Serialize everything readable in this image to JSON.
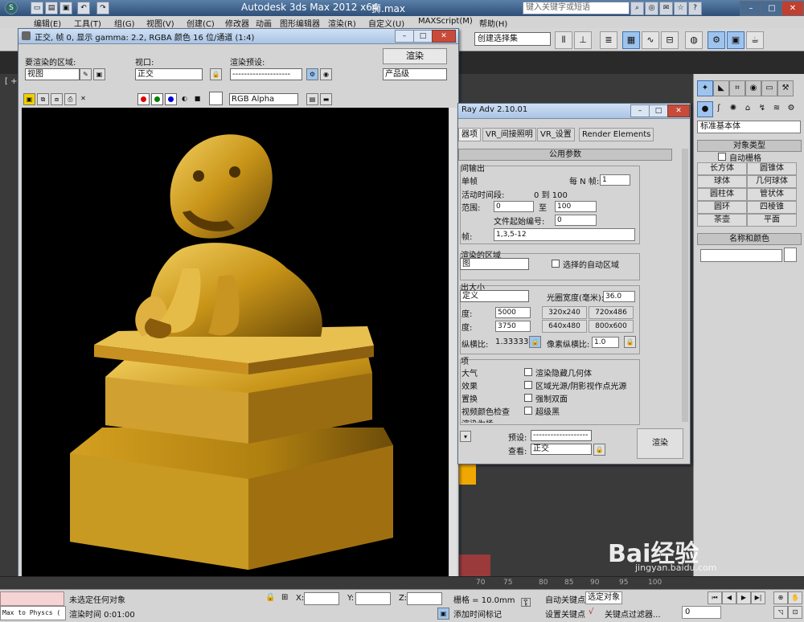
{
  "titlebar": {
    "title": "Autodesk 3ds Max  2012 x64",
    "file": "狮.max",
    "search_placeholder": "键入关键字或短语"
  },
  "menubar": {
    "items": [
      "编辑(E)",
      "工具(T)",
      "组(G)",
      "视图(V)",
      "创建(C)",
      "修改器",
      "动画",
      "图形编辑器",
      "渲染(R)",
      "自定义(U)",
      "MAXScript(M)",
      "帮助(H)"
    ]
  },
  "maintoolbar": {
    "selection_set": "创建选择集"
  },
  "viewport": {
    "label": "[ +"
  },
  "renderframe": {
    "title": "正交, 帧 0, 显示 gamma: 2.2, RGBA 颜色 16 位/通道 (1:4)",
    "area_label": "要渲染的区域:",
    "area_value": "视图",
    "viewport_label": "视口:",
    "viewport_value": "正交",
    "preset_label": "渲染预设:",
    "preset_value": "--------------------",
    "render_button": "渲染",
    "quality_value": "产品级",
    "channel_value": "RGB Alpha"
  },
  "rendersetup": {
    "title": "Ray Adv 2.10.01",
    "tabs": [
      "器项",
      "VR_间接照明",
      "VR_设置",
      "Render Elements"
    ],
    "rollout": "公用参数",
    "time_output_title": "间输出",
    "single": "单帧",
    "every_n": "每 N 帧:",
    "every_n_value": "1",
    "active_segment": "活动时间段:",
    "segment_value": "0 到 100",
    "range": "范围:",
    "range_start": "0",
    "range_to": "至",
    "range_end": "100",
    "file_start": "文件起始编号:",
    "file_start_value": "0",
    "frames_label": "帧:",
    "frames_value": "1,3,5-12",
    "area_title": "渲染的区域",
    "area_value": "图",
    "auto_region": "选择的自动区域",
    "size_title": "出大小",
    "custom": "定义",
    "aperture": "光圈宽度(毫米):",
    "aperture_value": "36.0",
    "width_label": "度:",
    "width_value": "5000",
    "height_label": "度:",
    "height_value": "3750",
    "presets": [
      "320x240",
      "720x486",
      "640x480",
      "800x600"
    ],
    "aspect_label": "纵横比:",
    "aspect_value": "1.33333",
    "pixel_aspect": "像素纵横比:",
    "pixel_aspect_value": "1.0",
    "options_title": "项",
    "opt_left": [
      "大气",
      "效果",
      "置换",
      "视频颜色检查",
      "渲染为场"
    ],
    "opt_right": [
      "渲染隐藏几何体",
      "区域光源/阴影视作点光源",
      "强制双面",
      "超级黑"
    ],
    "preset_label": "预设:",
    "preset_value": "--------------------",
    "view_label": "查看:",
    "view_value": "正交",
    "render": "渲染"
  },
  "cmdpanel": {
    "category": "标准基本体",
    "object_type": "对象类型",
    "autogrid": "自动栅格",
    "objects": [
      "长方体",
      "圆锥体",
      "球体",
      "几何球体",
      "圆柱体",
      "管状体",
      "圆环",
      "四棱锥",
      "茶壶",
      "平面"
    ],
    "name_color": "名称和颜色"
  },
  "timeline": {
    "ticks": [
      "70",
      "75",
      "80",
      "85",
      "90",
      "95",
      "100"
    ]
  },
  "statusbar": {
    "maxscript": "Max to Physcs (",
    "status": "未选定任何对象",
    "render_time": "渲染时间  0:01:00",
    "x": "X:",
    "y": "Y:",
    "z": "Z:",
    "grid": "栅格 = 10.0mm",
    "add_tag": "添加时间标记",
    "autokey": "自动关键点",
    "selected": "选定对象",
    "setkey": "设置关键点",
    "keyfilter": "关键点过滤器...",
    "frame": "0"
  },
  "watermark": {
    "brand": "Bai经验",
    "url": "jingyan.baidu.com"
  }
}
